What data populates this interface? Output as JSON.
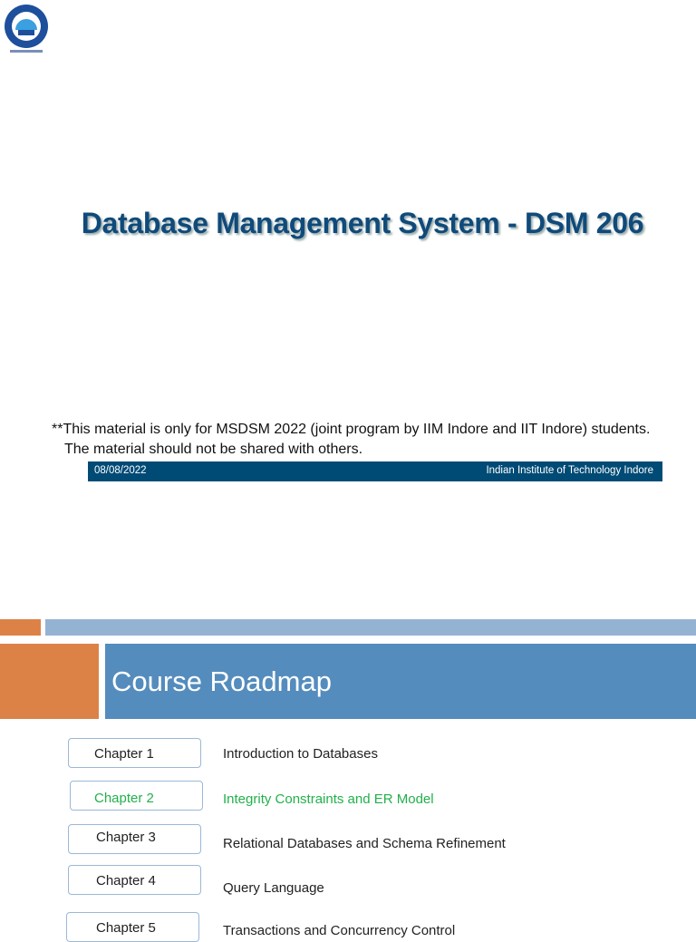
{
  "slide1": {
    "logo": "iit-indore-logo",
    "title": "Database Management System - DSM 206",
    "note_line1": "**This material is only for MSDSM 2022 (joint program by IIM Indore and IIT Indore) students.",
    "note_line2": "The material should not be shared with others.",
    "footer_date": "08/08/2022",
    "footer_institute": "Indian Institute of Technology Indore"
  },
  "slide2": {
    "title": "Course Roadmap",
    "chapters": [
      {
        "label": "Chapter 1",
        "topic": "Introduction to Databases"
      },
      {
        "label": "Chapter 2",
        "topic": "Integrity Constraints and ER Model",
        "highlight": true
      },
      {
        "label": "Chapter 3",
        "topic": "Relational Databases and Schema Refinement"
      },
      {
        "label": "Chapter 4",
        "topic": "Query Language"
      },
      {
        "label": "Chapter 5",
        "topic": "Transactions and Concurrency Control"
      }
    ]
  },
  "colors": {
    "title": "#0f4a7a",
    "footer": "#004b75",
    "orange": "#dd8246",
    "blue": "#548cbd",
    "highlight": "#22b04b"
  }
}
